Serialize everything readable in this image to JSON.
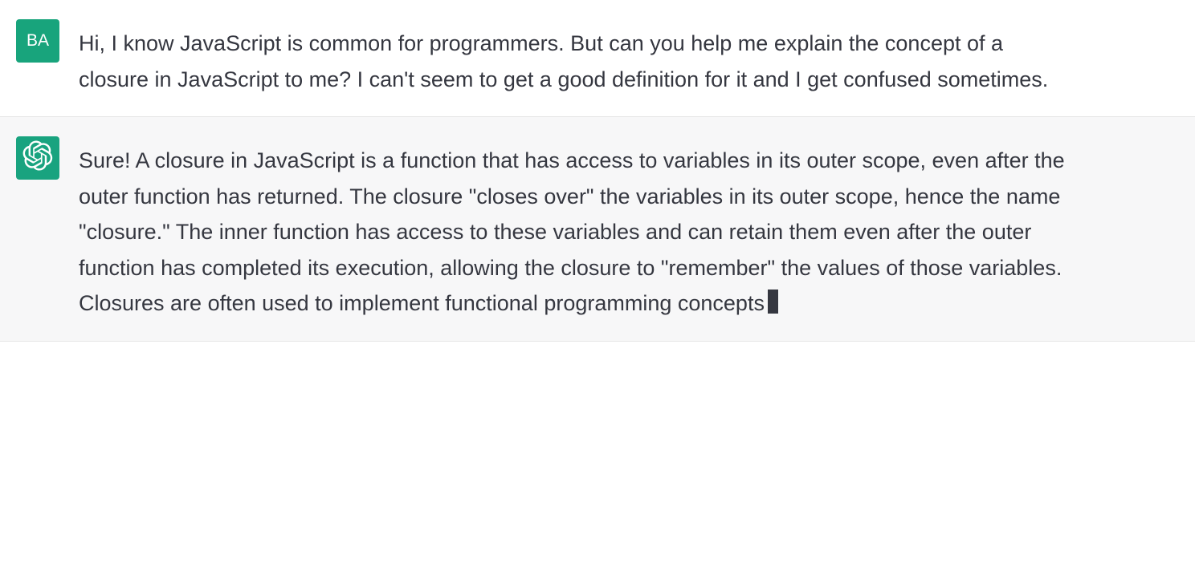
{
  "messages": [
    {
      "role": "user",
      "avatar_text": "BA",
      "content": "Hi, I know JavaScript is common for programmers. But can you help me explain the concept of a closure in JavaScript to me? I can't seem to get a good definition for it and I get confused sometimes."
    },
    {
      "role": "assistant",
      "content": "Sure! A closure in JavaScript is a function that has access to variables in its outer scope, even after the outer function has returned. The closure \"closes over\" the variables in its outer scope, hence the name \"closure.\" The inner function has access to these variables and can retain them even after the outer function has completed its execution, allowing the closure to \"remember\" the values of those variables. Closures are often used to implement functional programming concepts"
    }
  ]
}
